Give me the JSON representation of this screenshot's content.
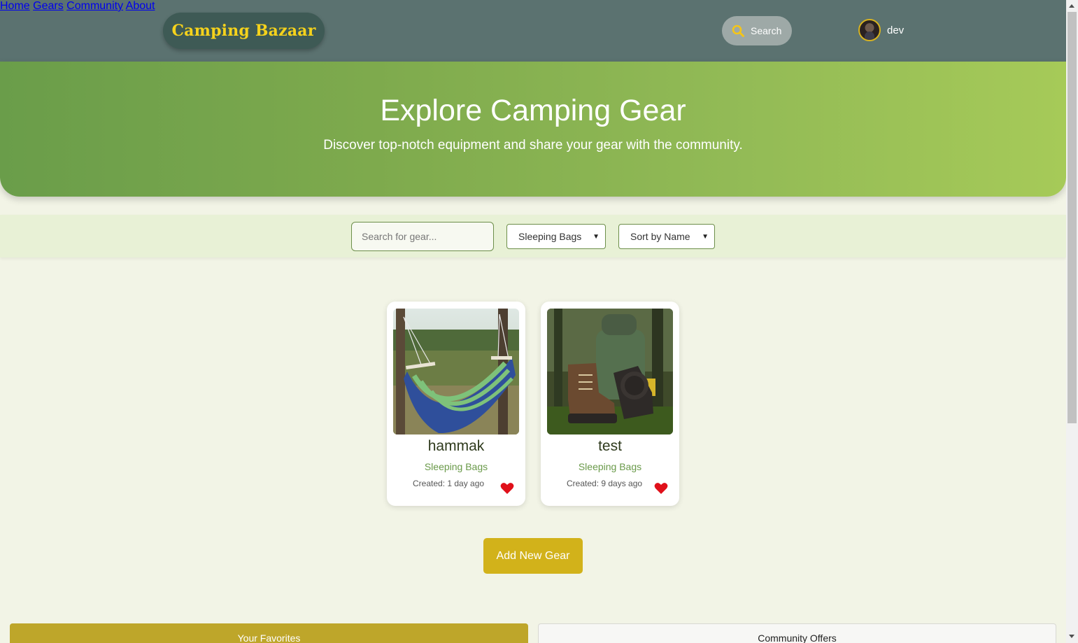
{
  "header": {
    "logo": "Camping Bazaar",
    "nav": [
      "Home",
      "Gears",
      "Community",
      "About"
    ],
    "search_label": "Search",
    "user_name": "dev"
  },
  "hero": {
    "title": "Explore Camping Gear",
    "subtitle": "Discover top-notch equipment and share your gear with the community."
  },
  "filters": {
    "search_placeholder": "Search for gear...",
    "category": "Sleeping Bags",
    "sort": "Sort by Name"
  },
  "cards": [
    {
      "title": "hammak",
      "category": "Sleeping Bags",
      "created": "Created: 1 day ago",
      "image": "hammock-photo"
    },
    {
      "title": "test",
      "category": "Sleeping Bags",
      "created": "Created: 9 days ago",
      "image": "hiking-boots-backpack-photo"
    }
  ],
  "add_button": "Add New Gear",
  "tabs": {
    "favorites": "Your Favorites",
    "offers": "Community Offers"
  },
  "colors": {
    "header_bg": "#5b7270",
    "logo_text": "#f5d21c",
    "accent": "#d2b21a",
    "heart": "#e0101a"
  }
}
